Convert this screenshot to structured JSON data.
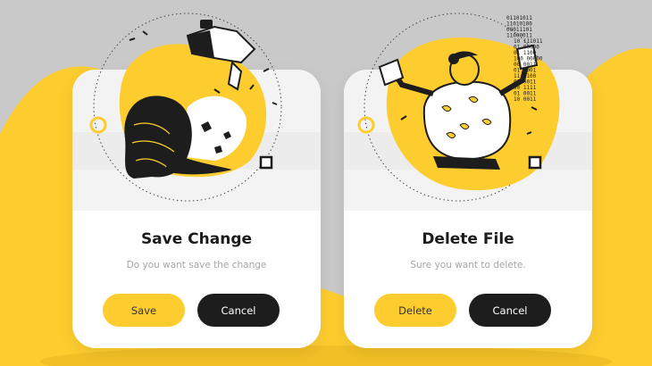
{
  "colors": {
    "accent": "#fdcd2f",
    "dark": "#1d1d1d",
    "background": "#c9c9c9",
    "card": "#ffffff"
  },
  "dialogs": [
    {
      "title": "Save Change",
      "message": "Do you want save the change",
      "primary_label": "Save",
      "secondary_label": "Cancel",
      "illustration_icon": "woman-puzzle-illustration-icon"
    },
    {
      "title": "Delete File",
      "message": "Sure you want to delete.",
      "primary_label": "Delete",
      "secondary_label": "Cancel",
      "illustration_icon": "man-delete-files-illustration-icon",
      "binary_text": [
        "01101011",
        "11010100",
        "00011101",
        "11000011",
        "10 111011",
        "01 00000",
        "01 1100",
        "100 00000",
        "00 0011",
        "01 0001",
        "11 1100",
        "01 0011",
        "00 1111",
        "01 0011",
        "10 0011"
      ]
    }
  ]
}
